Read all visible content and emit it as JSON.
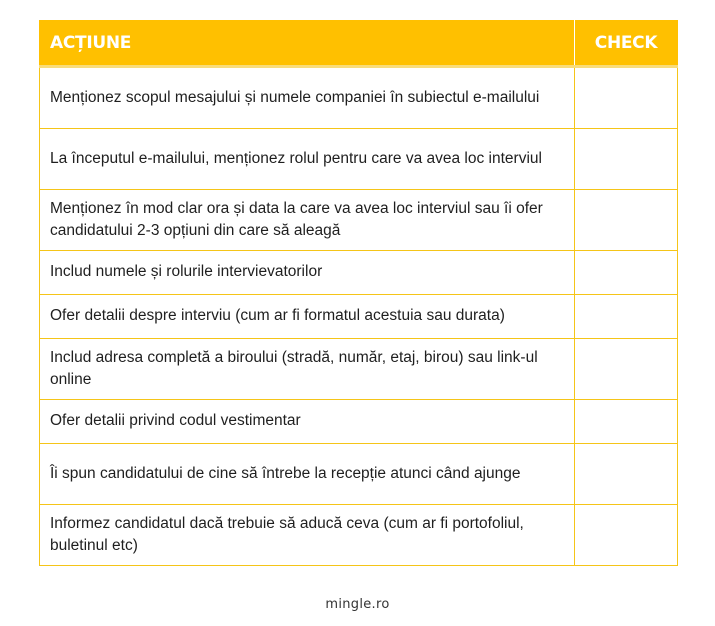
{
  "table": {
    "headers": {
      "action": "ACȚIUNE",
      "check": "CHECK"
    },
    "rows": [
      {
        "action": "Menționez scopul mesajului și numele companiei în subiectul e-mailului",
        "check": ""
      },
      {
        "action": "La începutul e-mailului, menționez rolul pentru care va avea loc interviul",
        "check": ""
      },
      {
        "action": "Menționez în mod clar ora și data la care va avea loc interviul sau îi ofer candidatului 2-3 opțiuni din care să aleagă",
        "check": ""
      },
      {
        "action": "Includ numele și rolurile intervievatorilor",
        "check": ""
      },
      {
        "action": "Ofer detalii despre interviu (cum ar fi formatul acestuia sau durata)",
        "check": ""
      },
      {
        "action": "Includ adresa completă a biroului (stradă, număr, etaj, birou) sau link-ul online",
        "check": ""
      },
      {
        "action": "Ofer detalii privind codul vestimentar",
        "check": ""
      },
      {
        "action": "Îi spun candidatului de cine să întrebe la recepție atunci când ajunge",
        "check": ""
      },
      {
        "action": "Informez candidatul dacă trebuie să aducă ceva (cum ar fi portofoliul, buletinul etc)",
        "check": ""
      }
    ]
  },
  "footer": {
    "source": "mingle.ro"
  },
  "colors": {
    "header_bg": "#FFC000",
    "header_text": "#FFFFFF",
    "border": "#F5C518"
  }
}
